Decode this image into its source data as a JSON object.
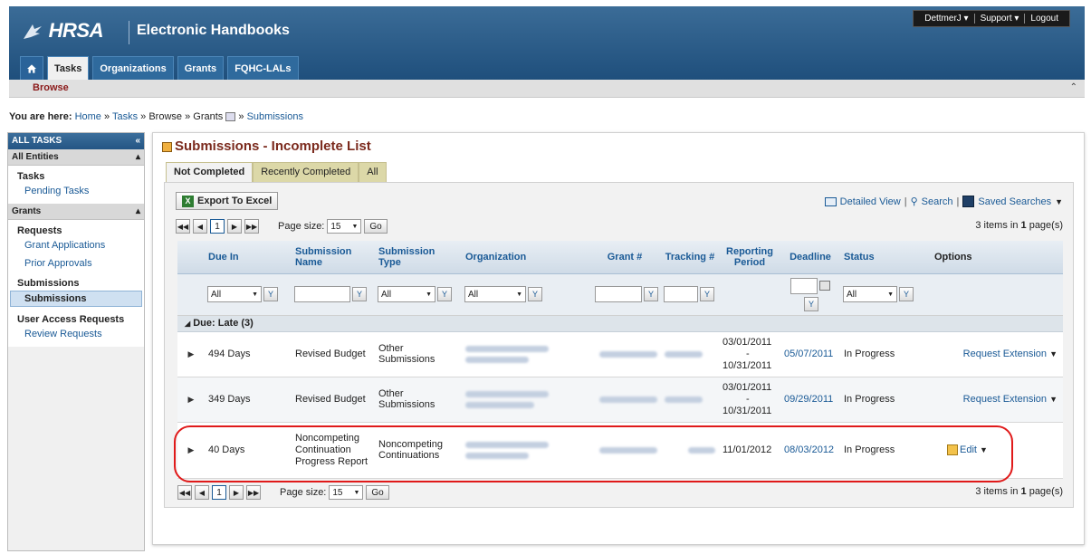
{
  "header": {
    "logo_text": "HRSA",
    "app_title": "Electronic Handbooks",
    "user_menu": [
      "DettmerJ ▾",
      "Support ▾",
      "Logout"
    ],
    "nav_tabs": [
      {
        "label": "Tasks",
        "active": true
      },
      {
        "label": "Organizations",
        "active": false
      },
      {
        "label": "Grants",
        "active": false
      },
      {
        "label": "FQHC-LALs",
        "active": false
      }
    ],
    "subnav": "Browse"
  },
  "breadcrumb": {
    "prefix": "You are here:",
    "items": [
      "Home",
      "Tasks",
      "Browse",
      "Grants",
      "Submissions"
    ],
    "sep": "»"
  },
  "sidebar": {
    "title": "ALL TASKS",
    "sections": [
      {
        "label": "All Entities"
      },
      {
        "label": "Grants"
      }
    ],
    "tasks_group": "Tasks",
    "pending_tasks": "Pending Tasks",
    "requests_group": "Requests",
    "grant_applications": "Grant Applications",
    "prior_approvals": "Prior Approvals",
    "submissions_group": "Submissions",
    "submissions_link": "Submissions",
    "uar_group": "User Access Requests",
    "review_requests": "Review Requests"
  },
  "main": {
    "title": "Submissions - Incomplete List",
    "tabs": [
      {
        "label": "Not Completed",
        "active": true
      },
      {
        "label": "Recently Completed",
        "active": false
      },
      {
        "label": "All",
        "active": false
      }
    ],
    "export_label": "Export To Excel",
    "detailed_view": "Detailed View",
    "search": "Search",
    "saved_searches": "Saved Searches",
    "pager": {
      "page": "1",
      "page_size_label": "Page size:",
      "page_size": "15",
      "go": "Go",
      "items_pre": "3 items in ",
      "pages_bold": "1",
      "items_post": " page(s)"
    },
    "columns": [
      "Due In",
      "Submission Name",
      "Submission Type",
      "Organization",
      "Grant #",
      "Tracking #",
      "Reporting Period",
      "Deadline",
      "Status",
      "Options"
    ],
    "filter_all": "All",
    "group_label": "Due: Late (3)",
    "rows": [
      {
        "due_in": "494 Days",
        "name": "Revised Budget",
        "type": "Other Submissions",
        "period_start": "03/01/2011",
        "period_dash": "-",
        "period_end": "10/31/2011",
        "deadline": "05/07/2011",
        "status": "In Progress",
        "option": "Request Extension"
      },
      {
        "due_in": "349 Days",
        "name": "Revised Budget",
        "type": "Other Submissions",
        "period_start": "03/01/2011",
        "period_dash": "-",
        "period_end": "10/31/2011",
        "deadline": "09/29/2011",
        "status": "In Progress",
        "option": "Request Extension"
      },
      {
        "due_in": "40 Days",
        "name": "Noncompeting Continuation Progress Report",
        "type": "Noncompeting Continuations",
        "period_start": "11/01/2012",
        "period_dash": "",
        "period_end": "",
        "deadline": "08/03/2012",
        "status": "In Progress",
        "option": "Edit"
      }
    ]
  },
  "colors": {
    "header": "#2a5d8a",
    "title": "#7b2a1d",
    "link": "#1a5a96",
    "highlight": "#e01a1a"
  }
}
